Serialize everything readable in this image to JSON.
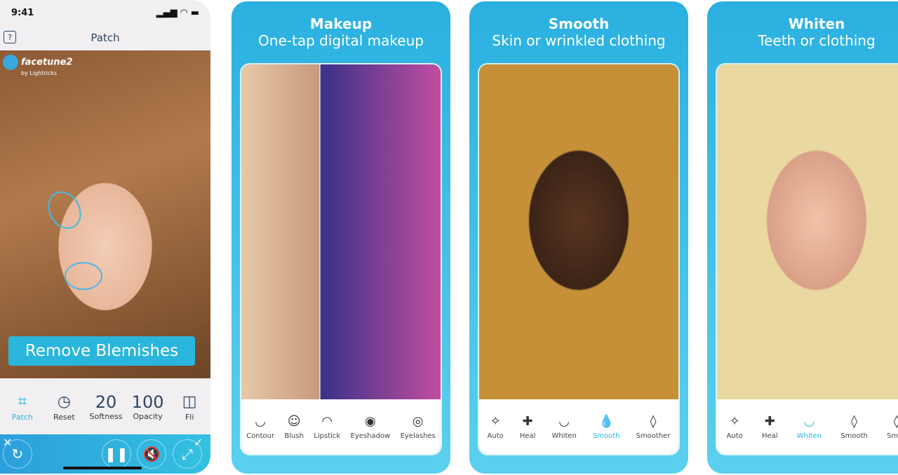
{
  "phone": {
    "time": "9:41",
    "signal": "▂▄▆",
    "nav_title": "Patch",
    "help": "?",
    "logo": "facetune2",
    "logo_sub": "by Lightricks",
    "badge": "Remove Blemishes",
    "tools": [
      {
        "icon": "patch-icon",
        "glyph": "⌗",
        "label": "Patch",
        "active": true
      },
      {
        "icon": "reset-icon",
        "glyph": "◷",
        "label": "Reset"
      },
      {
        "value": "20",
        "label": "Softness"
      },
      {
        "value": "100",
        "label": "Opacity"
      },
      {
        "icon": "flip-icon",
        "glyph": "◫",
        "label": "Fli"
      }
    ]
  },
  "cards": [
    {
      "title": "Makeup",
      "subtitle": "One-tap digital makeup",
      "tools": [
        {
          "icon": "contour-icon",
          "glyph": "◡",
          "label": "Contour"
        },
        {
          "icon": "blush-icon",
          "glyph": "☺",
          "label": "Blush"
        },
        {
          "icon": "lipstick-icon",
          "glyph": "◠",
          "label": "Lipstick"
        },
        {
          "icon": "eyeshadow-icon",
          "glyph": "◉",
          "label": "Eyeshadow"
        },
        {
          "icon": "eyelashes-icon",
          "glyph": "◎",
          "label": "Eyelashes"
        }
      ]
    },
    {
      "title": "Smooth",
      "subtitle": "Skin or wrinkled clothing",
      "tools": [
        {
          "icon": "auto-icon",
          "glyph": "✧",
          "label": "Auto"
        },
        {
          "icon": "heal-icon",
          "glyph": "✚",
          "label": "Heal"
        },
        {
          "icon": "whiten-icon",
          "glyph": "◡",
          "label": "Whiten"
        },
        {
          "icon": "smooth-icon",
          "glyph": "💧",
          "label": "Smooth",
          "active": true
        },
        {
          "icon": "smoother-icon",
          "glyph": "◊",
          "label": "Smoother"
        }
      ]
    },
    {
      "title": "Whiten",
      "subtitle": "Teeth or clothing",
      "tools": [
        {
          "icon": "auto-icon",
          "glyph": "✧",
          "label": "Auto"
        },
        {
          "icon": "heal-icon",
          "glyph": "✚",
          "label": "Heal"
        },
        {
          "icon": "whiten-icon",
          "glyph": "◡",
          "label": "Whiten",
          "active": true
        },
        {
          "icon": "smooth-icon",
          "glyph": "◊",
          "label": "Smooth"
        },
        {
          "icon": "smoother-icon",
          "glyph": "◊",
          "label": "Smoo"
        }
      ]
    }
  ],
  "colors": {
    "accent": "#2ab6dc"
  }
}
